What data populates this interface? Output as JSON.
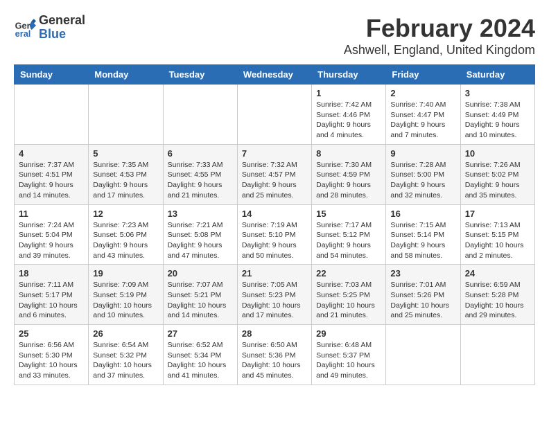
{
  "header": {
    "logo_line1": "General",
    "logo_line2": "Blue",
    "title": "February 2024",
    "subtitle": "Ashwell, England, United Kingdom"
  },
  "columns": [
    "Sunday",
    "Monday",
    "Tuesday",
    "Wednesday",
    "Thursday",
    "Friday",
    "Saturday"
  ],
  "weeks": [
    [
      {
        "day": "",
        "info": ""
      },
      {
        "day": "",
        "info": ""
      },
      {
        "day": "",
        "info": ""
      },
      {
        "day": "",
        "info": ""
      },
      {
        "day": "1",
        "info": "Sunrise: 7:42 AM\nSunset: 4:46 PM\nDaylight: 9 hours\nand 4 minutes."
      },
      {
        "day": "2",
        "info": "Sunrise: 7:40 AM\nSunset: 4:47 PM\nDaylight: 9 hours\nand 7 minutes."
      },
      {
        "day": "3",
        "info": "Sunrise: 7:38 AM\nSunset: 4:49 PM\nDaylight: 9 hours\nand 10 minutes."
      }
    ],
    [
      {
        "day": "4",
        "info": "Sunrise: 7:37 AM\nSunset: 4:51 PM\nDaylight: 9 hours\nand 14 minutes."
      },
      {
        "day": "5",
        "info": "Sunrise: 7:35 AM\nSunset: 4:53 PM\nDaylight: 9 hours\nand 17 minutes."
      },
      {
        "day": "6",
        "info": "Sunrise: 7:33 AM\nSunset: 4:55 PM\nDaylight: 9 hours\nand 21 minutes."
      },
      {
        "day": "7",
        "info": "Sunrise: 7:32 AM\nSunset: 4:57 PM\nDaylight: 9 hours\nand 25 minutes."
      },
      {
        "day": "8",
        "info": "Sunrise: 7:30 AM\nSunset: 4:59 PM\nDaylight: 9 hours\nand 28 minutes."
      },
      {
        "day": "9",
        "info": "Sunrise: 7:28 AM\nSunset: 5:00 PM\nDaylight: 9 hours\nand 32 minutes."
      },
      {
        "day": "10",
        "info": "Sunrise: 7:26 AM\nSunset: 5:02 PM\nDaylight: 9 hours\nand 35 minutes."
      }
    ],
    [
      {
        "day": "11",
        "info": "Sunrise: 7:24 AM\nSunset: 5:04 PM\nDaylight: 9 hours\nand 39 minutes."
      },
      {
        "day": "12",
        "info": "Sunrise: 7:23 AM\nSunset: 5:06 PM\nDaylight: 9 hours\nand 43 minutes."
      },
      {
        "day": "13",
        "info": "Sunrise: 7:21 AM\nSunset: 5:08 PM\nDaylight: 9 hours\nand 47 minutes."
      },
      {
        "day": "14",
        "info": "Sunrise: 7:19 AM\nSunset: 5:10 PM\nDaylight: 9 hours\nand 50 minutes."
      },
      {
        "day": "15",
        "info": "Sunrise: 7:17 AM\nSunset: 5:12 PM\nDaylight: 9 hours\nand 54 minutes."
      },
      {
        "day": "16",
        "info": "Sunrise: 7:15 AM\nSunset: 5:14 PM\nDaylight: 9 hours\nand 58 minutes."
      },
      {
        "day": "17",
        "info": "Sunrise: 7:13 AM\nSunset: 5:15 PM\nDaylight: 10 hours\nand 2 minutes."
      }
    ],
    [
      {
        "day": "18",
        "info": "Sunrise: 7:11 AM\nSunset: 5:17 PM\nDaylight: 10 hours\nand 6 minutes."
      },
      {
        "day": "19",
        "info": "Sunrise: 7:09 AM\nSunset: 5:19 PM\nDaylight: 10 hours\nand 10 minutes."
      },
      {
        "day": "20",
        "info": "Sunrise: 7:07 AM\nSunset: 5:21 PM\nDaylight: 10 hours\nand 14 minutes."
      },
      {
        "day": "21",
        "info": "Sunrise: 7:05 AM\nSunset: 5:23 PM\nDaylight: 10 hours\nand 17 minutes."
      },
      {
        "day": "22",
        "info": "Sunrise: 7:03 AM\nSunset: 5:25 PM\nDaylight: 10 hours\nand 21 minutes."
      },
      {
        "day": "23",
        "info": "Sunrise: 7:01 AM\nSunset: 5:26 PM\nDaylight: 10 hours\nand 25 minutes."
      },
      {
        "day": "24",
        "info": "Sunrise: 6:59 AM\nSunset: 5:28 PM\nDaylight: 10 hours\nand 29 minutes."
      }
    ],
    [
      {
        "day": "25",
        "info": "Sunrise: 6:56 AM\nSunset: 5:30 PM\nDaylight: 10 hours\nand 33 minutes."
      },
      {
        "day": "26",
        "info": "Sunrise: 6:54 AM\nSunset: 5:32 PM\nDaylight: 10 hours\nand 37 minutes."
      },
      {
        "day": "27",
        "info": "Sunrise: 6:52 AM\nSunset: 5:34 PM\nDaylight: 10 hours\nand 41 minutes."
      },
      {
        "day": "28",
        "info": "Sunrise: 6:50 AM\nSunset: 5:36 PM\nDaylight: 10 hours\nand 45 minutes."
      },
      {
        "day": "29",
        "info": "Sunrise: 6:48 AM\nSunset: 5:37 PM\nDaylight: 10 hours\nand 49 minutes."
      },
      {
        "day": "",
        "info": ""
      },
      {
        "day": "",
        "info": ""
      }
    ]
  ]
}
